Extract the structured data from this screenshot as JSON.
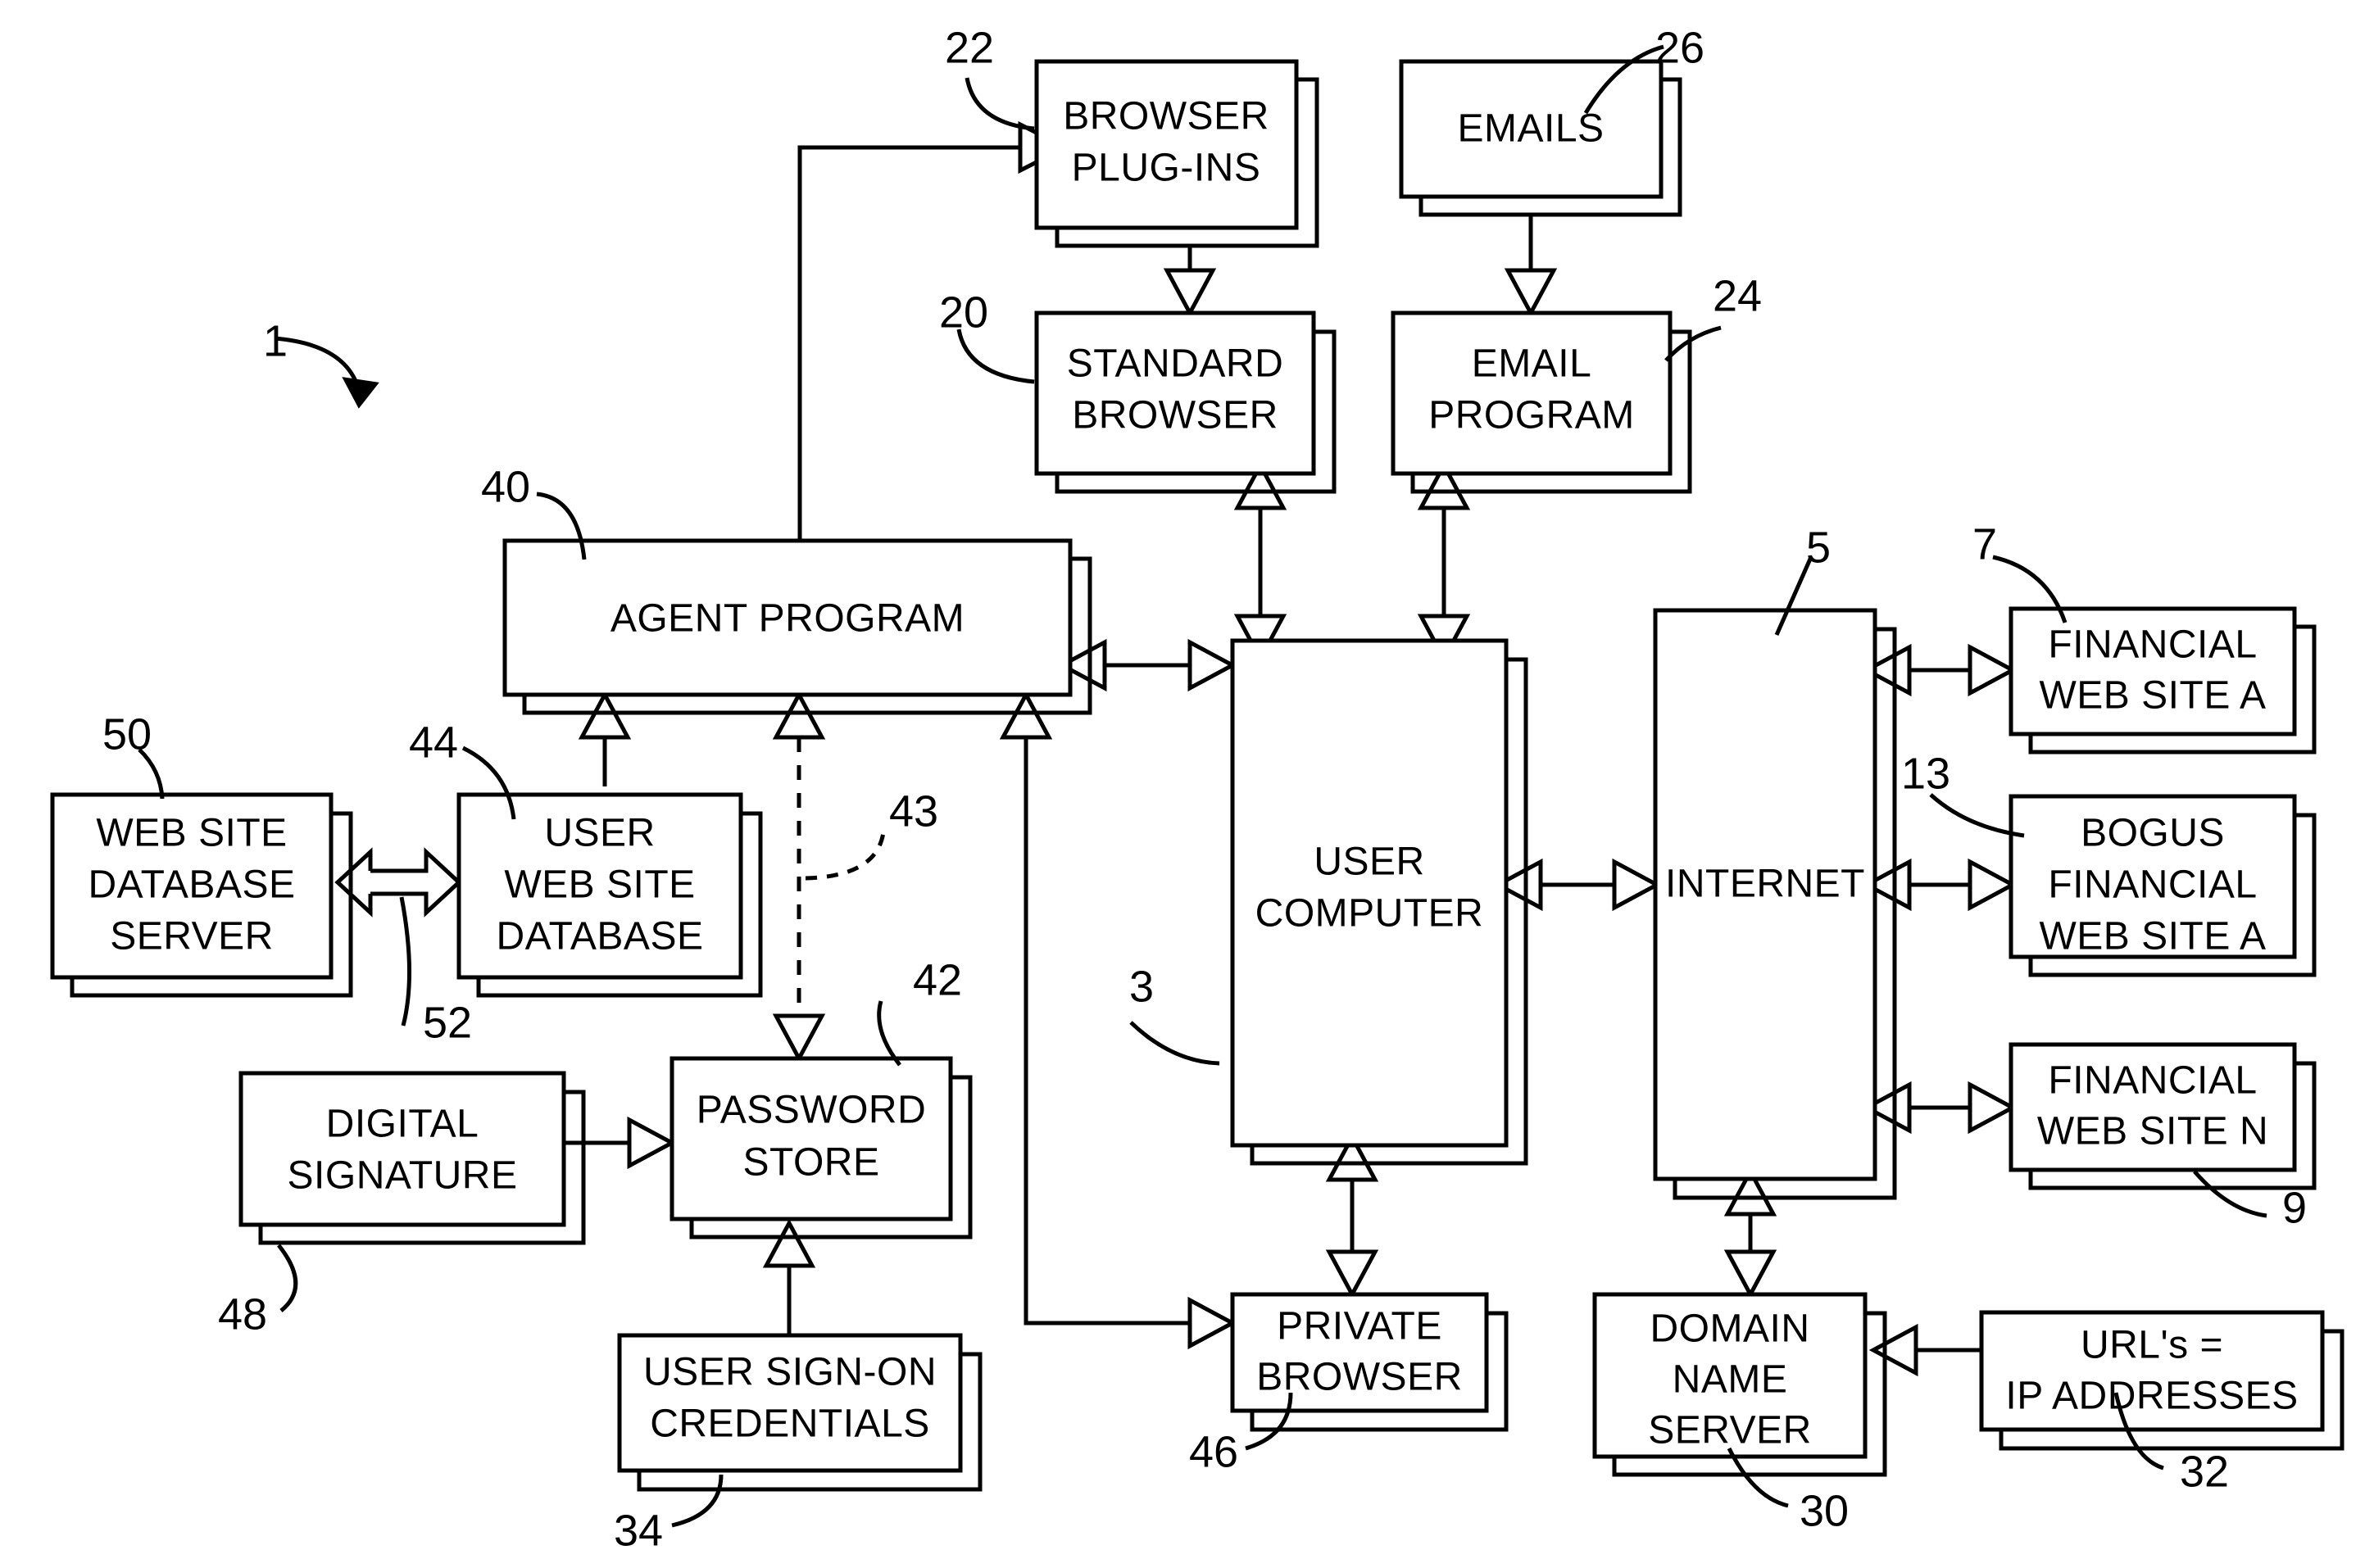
{
  "figure": {
    "title": "Anti-phishing agent program system block diagram",
    "figure_reference": "1"
  },
  "boxes": [
    {
      "id": "browser_plugins",
      "label_lines": [
        "BROWSER",
        "PLUG-INS"
      ],
      "ref": "22"
    },
    {
      "id": "emails",
      "label_lines": [
        "EMAILS"
      ],
      "ref": "26"
    },
    {
      "id": "standard_browser",
      "label_lines": [
        "STANDARD",
        "BROWSER"
      ],
      "ref": "20"
    },
    {
      "id": "email_program",
      "label_lines": [
        "EMAIL",
        "PROGRAM"
      ],
      "ref": "24"
    },
    {
      "id": "agent_program",
      "label_lines": [
        "AGENT PROGRAM"
      ],
      "ref": "40"
    },
    {
      "id": "user_computer",
      "label_lines": [
        "USER",
        "COMPUTER"
      ],
      "ref": "3"
    },
    {
      "id": "internet",
      "label_lines": [
        "INTERNET"
      ],
      "ref": "5"
    },
    {
      "id": "financial_a",
      "label_lines": [
        "FINANCIAL",
        "WEB SITE A"
      ],
      "ref": "7"
    },
    {
      "id": "bogus_financial_a",
      "label_lines": [
        "BOGUS",
        "FINANCIAL",
        "WEB SITE A"
      ],
      "ref": "13"
    },
    {
      "id": "financial_n",
      "label_lines": [
        "FINANCIAL",
        "WEB SITE N"
      ],
      "ref": "9"
    },
    {
      "id": "web_site_db_server",
      "label_lines": [
        "WEB SITE",
        "DATABASE",
        "SERVER"
      ],
      "ref": "50"
    },
    {
      "id": "user_web_site_db",
      "label_lines": [
        "USER",
        "WEB SITE",
        "DATABASE"
      ],
      "ref": "44"
    },
    {
      "id": "digital_signature",
      "label_lines": [
        "DIGITAL",
        "SIGNATURE"
      ],
      "ref": "48"
    },
    {
      "id": "password_store",
      "label_lines": [
        "PASSWORD",
        "STORE"
      ],
      "ref": "42"
    },
    {
      "id": "user_signon",
      "label_lines": [
        "USER SIGN-ON",
        "CREDENTIALS"
      ],
      "ref": "34"
    },
    {
      "id": "private_browser",
      "label_lines": [
        "PRIVATE",
        "BROWSER"
      ],
      "ref": "46"
    },
    {
      "id": "domain_name_server",
      "label_lines": [
        "DOMAIN",
        "NAME",
        "SERVER"
      ],
      "ref": "30"
    },
    {
      "id": "urls_ip",
      "label_lines": [
        "URL's =",
        "IP ADDRESSES"
      ],
      "ref": "32"
    }
  ],
  "reference_numerals": [
    {
      "id": "ref-1",
      "text": "1"
    },
    {
      "id": "ref-3",
      "text": "3"
    },
    {
      "id": "ref-5",
      "text": "5"
    },
    {
      "id": "ref-7",
      "text": "7"
    },
    {
      "id": "ref-9",
      "text": "9"
    },
    {
      "id": "ref-13",
      "text": "13"
    },
    {
      "id": "ref-20",
      "text": "20"
    },
    {
      "id": "ref-22",
      "text": "22"
    },
    {
      "id": "ref-24",
      "text": "24"
    },
    {
      "id": "ref-26",
      "text": "26"
    },
    {
      "id": "ref-30",
      "text": "30"
    },
    {
      "id": "ref-32",
      "text": "32"
    },
    {
      "id": "ref-34",
      "text": "34"
    },
    {
      "id": "ref-40",
      "text": "40"
    },
    {
      "id": "ref-42",
      "text": "42"
    },
    {
      "id": "ref-43",
      "text": "43"
    },
    {
      "id": "ref-44",
      "text": "44"
    },
    {
      "id": "ref-46",
      "text": "46"
    },
    {
      "id": "ref-48",
      "text": "48"
    },
    {
      "id": "ref-50",
      "text": "50"
    },
    {
      "id": "ref-52",
      "text": "52"
    }
  ],
  "text": {
    "browser_plugins_1": "BROWSER",
    "browser_plugins_2": "PLUG-INS",
    "emails_1": "EMAILS",
    "standard_browser_1": "STANDARD",
    "standard_browser_2": "BROWSER",
    "email_program_1": "EMAIL",
    "email_program_2": "PROGRAM",
    "agent_program_1": "AGENT PROGRAM",
    "user_computer_1": "USER",
    "user_computer_2": "COMPUTER",
    "internet_1": "INTERNET",
    "financial_a_1": "FINANCIAL",
    "financial_a_2": "WEB SITE A",
    "bogus_1": "BOGUS",
    "bogus_2": "FINANCIAL",
    "bogus_3": "WEB SITE A",
    "financial_n_1": "FINANCIAL",
    "financial_n_2": "WEB SITE N",
    "wsdbs_1": "WEB SITE",
    "wsdbs_2": "DATABASE",
    "wsdbs_3": "SERVER",
    "uwsdb_1": "USER",
    "uwsdb_2": "WEB SITE",
    "uwsdb_3": "DATABASE",
    "digsig_1": "DIGITAL",
    "digsig_2": "SIGNATURE",
    "pwstore_1": "PASSWORD",
    "pwstore_2": "STORE",
    "signon_1": "USER SIGN-ON",
    "signon_2": "CREDENTIALS",
    "privbrowser_1": "PRIVATE",
    "privbrowser_2": "BROWSER",
    "dns_1": "DOMAIN",
    "dns_2": "NAME",
    "dns_3": "SERVER",
    "urls_1": "URL's =",
    "urls_2": "IP ADDRESSES"
  },
  "connections": [
    {
      "from": "agent_program",
      "to": "browser_plugins",
      "style": "solid",
      "arrows": "one"
    },
    {
      "from": "browser_plugins",
      "to": "standard_browser",
      "style": "solid",
      "arrows": "one"
    },
    {
      "from": "emails",
      "to": "email_program",
      "style": "solid",
      "arrows": "one"
    },
    {
      "from": "standard_browser",
      "to": "user_computer",
      "style": "solid",
      "arrows": "both"
    },
    {
      "from": "email_program",
      "to": "user_computer",
      "style": "solid",
      "arrows": "both"
    },
    {
      "from": "agent_program",
      "to": "user_computer",
      "style": "solid",
      "arrows": "both"
    },
    {
      "from": "user_computer",
      "to": "internet",
      "style": "solid",
      "arrows": "both"
    },
    {
      "from": "internet",
      "to": "financial_a",
      "style": "solid",
      "arrows": "both"
    },
    {
      "from": "internet",
      "to": "bogus_financial_a",
      "style": "solid",
      "arrows": "both"
    },
    {
      "from": "internet",
      "to": "financial_n",
      "style": "solid",
      "arrows": "both"
    },
    {
      "from": "internet",
      "to": "domain_name_server",
      "style": "solid",
      "arrows": "both"
    },
    {
      "from": "urls_ip",
      "to": "domain_name_server",
      "style": "solid",
      "arrows": "one"
    },
    {
      "from": "user_computer",
      "to": "private_browser",
      "style": "solid",
      "arrows": "both"
    },
    {
      "from": "private_browser",
      "to": "agent_program",
      "style": "solid",
      "arrows": "both"
    },
    {
      "from": "web_site_db_server",
      "to": "user_web_site_db",
      "style": "solid",
      "arrows": "both"
    },
    {
      "from": "user_web_site_db",
      "to": "agent_program",
      "style": "solid",
      "arrows": "one"
    },
    {
      "from": "agent_program",
      "to": "password_store",
      "style": "dashed",
      "arrows": "one"
    },
    {
      "from": "digital_signature",
      "to": "password_store",
      "style": "solid",
      "arrows": "one"
    },
    {
      "from": "user_signon",
      "to": "password_store",
      "style": "solid",
      "arrows": "one"
    }
  ],
  "colors": {
    "line": "#000000",
    "fill": "#ffffff",
    "text": "#000000"
  }
}
